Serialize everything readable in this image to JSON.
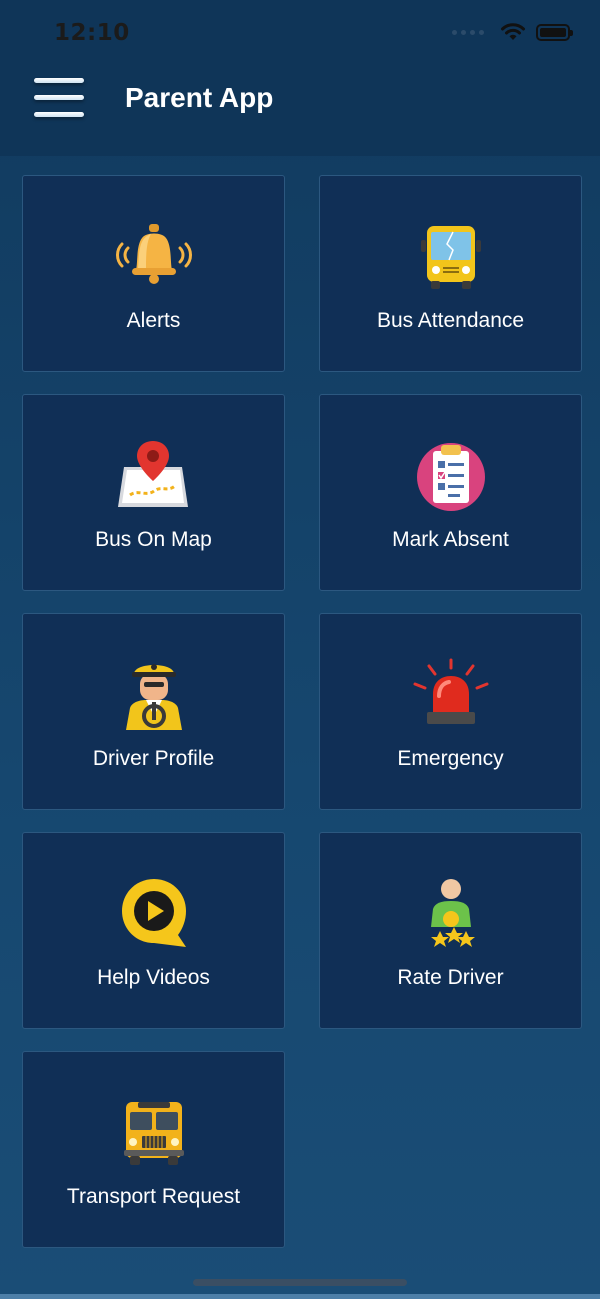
{
  "status_bar": {
    "time": "12:10"
  },
  "app_bar": {
    "title": "Parent App",
    "menu_icon": "hamburger-menu-icon"
  },
  "tiles": [
    {
      "label": "Alerts",
      "icon": "bell-icon"
    },
    {
      "label": "Bus Attendance",
      "icon": "bus-front-icon"
    },
    {
      "label": "Bus On Map",
      "icon": "map-pin-icon"
    },
    {
      "label": "Mark Absent",
      "icon": "clipboard-checklist-icon"
    },
    {
      "label": "Driver Profile",
      "icon": "driver-icon"
    },
    {
      "label": "Emergency",
      "icon": "siren-icon"
    },
    {
      "label": "Help Videos",
      "icon": "play-video-icon"
    },
    {
      "label": "Rate Driver",
      "icon": "rate-stars-icon"
    },
    {
      "label": "Transport Request",
      "icon": "school-bus-icon"
    }
  ],
  "colors": {
    "background": "#113a5e",
    "app_bar": "#0f3558",
    "tile": "#102f56",
    "tile_border": "#2c5880"
  }
}
